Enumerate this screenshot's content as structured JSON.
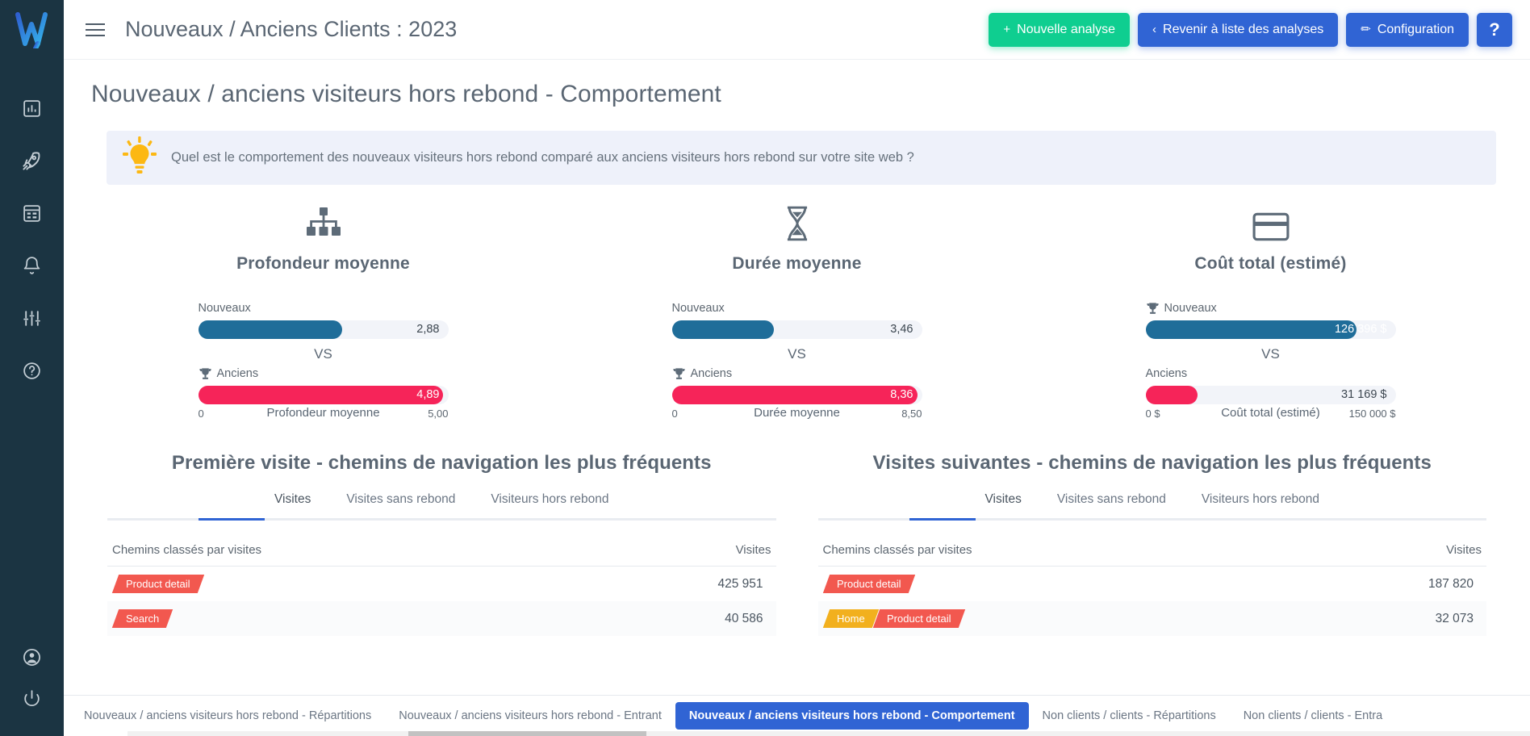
{
  "brand": {
    "logo_alt": "W",
    "accent_blue": "#3064d4",
    "accent_green": "#0fce90",
    "bar_blue": "#1f6d99",
    "bar_pink": "#f62459"
  },
  "header": {
    "title": "Nouveaux / Anciens Clients : 2023",
    "menu_icon": "hamburger-icon",
    "buttons": {
      "new_analysis": "Nouvelle analyse",
      "new_analysis_glyph": "+",
      "back_to_list": "Revenir à liste des analyses",
      "back_glyph": "‹",
      "configuration": "Configuration",
      "configuration_glyph": "✏",
      "help": "?"
    }
  },
  "sidebar": {
    "items": [
      {
        "name": "dashboard-icon",
        "label": "Tableau de bord"
      },
      {
        "name": "rocket-icon",
        "label": "Analyses"
      },
      {
        "name": "report-icon",
        "label": "Rapports"
      },
      {
        "name": "bell-icon",
        "label": "Alertes"
      },
      {
        "name": "sliders-icon",
        "label": "Paramètres"
      },
      {
        "name": "help-circle-icon",
        "label": "Aide"
      }
    ],
    "bottom_items": [
      {
        "name": "user-account-icon",
        "label": "Compte"
      },
      {
        "name": "power-icon",
        "label": "Déconnexion"
      }
    ]
  },
  "page": {
    "title": "Nouveaux / anciens visiteurs hors rebond - Comportement",
    "banner": {
      "icon": "lightbulb-icon",
      "text": "Quel est le comportement des nouveaux visiteurs hors rebond comparé aux anciens visiteurs hors rebond sur votre site web ?"
    }
  },
  "chart_data": [
    {
      "type": "bar",
      "title": "Profondeur moyenne",
      "icon": "sitemap-icon",
      "xlabel": "Profondeur moyenne",
      "categories": [
        "Nouveaux",
        "Anciens"
      ],
      "values": [
        2.88,
        4.89
      ],
      "value_labels": [
        "2,88",
        "4,89"
      ],
      "axis_min_label": "0",
      "axis_max_label": "5,00",
      "xlim": [
        0,
        5.0
      ],
      "winner": "Anciens",
      "separator": "VS",
      "series_colors": [
        "#1f6d99",
        "#f62459"
      ]
    },
    {
      "type": "bar",
      "title": "Durée moyenne",
      "icon": "hourglass-icon",
      "xlabel": "Durée moyenne",
      "categories": [
        "Nouveaux",
        "Anciens"
      ],
      "values": [
        3.46,
        8.36
      ],
      "value_labels": [
        "3,46",
        "8,36"
      ],
      "axis_min_label": "0",
      "axis_max_label": "8,50",
      "xlim": [
        0,
        8.5
      ],
      "winner": "Anciens",
      "separator": "VS",
      "series_colors": [
        "#1f6d99",
        "#f62459"
      ]
    },
    {
      "type": "bar",
      "title": "Coût total (estimé)",
      "icon": "credit-card-icon",
      "xlabel": "Coût total (estimé)",
      "categories": [
        "Nouveaux",
        "Anciens"
      ],
      "values": [
        126396,
        31169
      ],
      "value_labels": [
        "126 396 $",
        "31 169 $"
      ],
      "axis_min_label": "0 $",
      "axis_max_label": "150 000 $",
      "xlim": [
        0,
        150000
      ],
      "winner": "Nouveaux",
      "separator": "VS",
      "series_colors": [
        "#1f6d99",
        "#f62459"
      ]
    }
  ],
  "paths": {
    "first_visit": {
      "title": "Première visite - chemins de navigation les plus fréquents",
      "tabs": [
        {
          "label": "Visites",
          "active": true
        },
        {
          "label": "Visites sans rebond",
          "active": false
        },
        {
          "label": "Visiteurs hors rebond",
          "active": false
        }
      ],
      "col_path": "Chemins classés par visites",
      "col_value": "Visites",
      "rows": [
        {
          "chips": [
            {
              "label": "Product detail",
              "color": "red"
            }
          ],
          "value": "425 951"
        },
        {
          "chips": [
            {
              "label": "Search",
              "color": "red"
            }
          ],
          "value": "40 586"
        }
      ]
    },
    "next_visits": {
      "title": "Visites suivantes - chemins de navigation les plus fréquents",
      "tabs": [
        {
          "label": "Visites",
          "active": true
        },
        {
          "label": "Visites sans rebond",
          "active": false
        },
        {
          "label": "Visiteurs hors rebond",
          "active": false
        }
      ],
      "col_path": "Chemins classés par visites",
      "col_value": "Visites",
      "rows": [
        {
          "chips": [
            {
              "label": "Product detail",
              "color": "red"
            }
          ],
          "value": "187 820"
        },
        {
          "chips": [
            {
              "label": "Home",
              "color": "yellow"
            },
            {
              "label": "Product detail",
              "color": "red"
            }
          ],
          "value": "32 073"
        }
      ]
    }
  },
  "bottom_tabs": [
    {
      "label": "Nouveaux / anciens visiteurs hors rebond - Répartitions",
      "active": false
    },
    {
      "label": "Nouveaux / anciens visiteurs hors rebond - Entrant",
      "active": false
    },
    {
      "label": "Nouveaux / anciens visiteurs hors rebond - Comportement",
      "active": true
    },
    {
      "label": "Non clients / clients - Répartitions",
      "active": false
    },
    {
      "label": "Non clients / clients - Entra",
      "active": false
    }
  ]
}
